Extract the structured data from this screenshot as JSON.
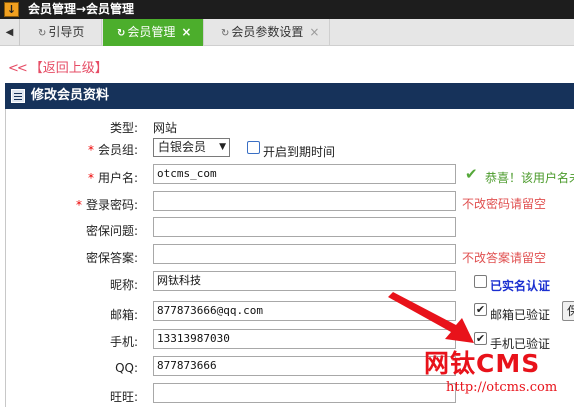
{
  "title_bar": {
    "text": "会员管理→会员管理",
    "icon": "download-arrow-icon"
  },
  "tabs": [
    {
      "label": "引导页",
      "icon": "refresh-icon",
      "active": false
    },
    {
      "label": "会员管理",
      "icon": "refresh-icon",
      "close": "×",
      "active": true
    },
    {
      "label": "会员参数设置",
      "icon": "refresh-icon",
      "close": "×",
      "active": false
    }
  ],
  "tab_scroll_left": "◀",
  "back_link": {
    "chevrons": "<<",
    "label": "【返回上级】"
  },
  "panel_title": "修改会员资料",
  "form": {
    "type": {
      "label": "类型:",
      "value": "网站"
    },
    "group": {
      "label": "会员组:",
      "value": "白银会员",
      "arrow": "▼",
      "expiry_label": "开启到期时间"
    },
    "username": {
      "label": "用户名:",
      "value": "otcms_com",
      "ok_mark": "✔",
      "ok_text": "恭喜！该用户名未"
    },
    "password": {
      "label": "登录密码:",
      "value": "",
      "hint": "不改密码请留空"
    },
    "question": {
      "label": "密保问题:",
      "value": ""
    },
    "answer": {
      "label": "密保答案:",
      "value": "",
      "hint": "不改答案请留空"
    },
    "nickname": {
      "label": "昵称:",
      "value": "网钛科技",
      "real_name_label": "已实名认证"
    },
    "email": {
      "label": "邮箱:",
      "value": "877873666@qq.com",
      "verified_label": "邮箱已验证",
      "side_button": "保"
    },
    "phone": {
      "label": "手机:",
      "value": "13313987030",
      "verified_label": "手机已验证"
    },
    "qq": {
      "label": "QQ:",
      "value": "877873666"
    },
    "wangwang": {
      "label": "旺旺:",
      "value": ""
    }
  },
  "watermark": {
    "title": "网钛CMS",
    "url": "http://otcms.com"
  },
  "colors": {
    "active_tab": "#4cae2c",
    "panel_header": "#16325a",
    "required": "#e00000",
    "hint": "#e05050",
    "watermark": "#e8121a",
    "arrow": "#e8121a"
  }
}
